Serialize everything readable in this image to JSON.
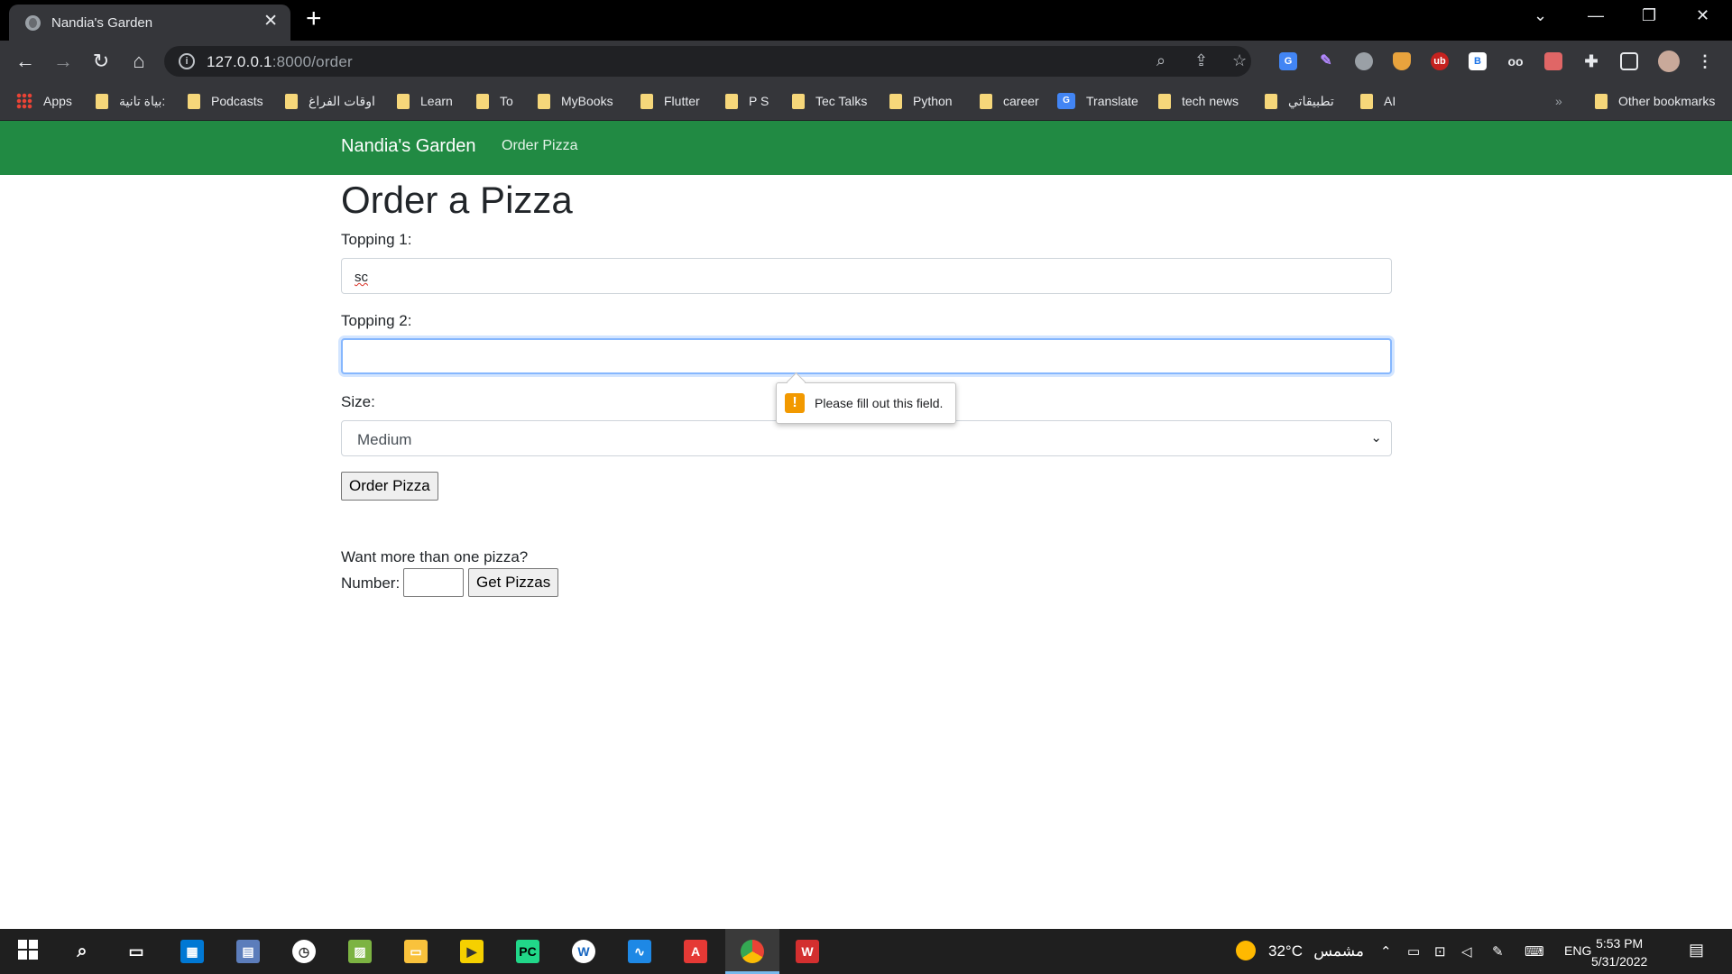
{
  "browser": {
    "tab_title": "Nandia's Garden",
    "tab_close": "✕",
    "new_tab": "+",
    "window_controls": [
      "⌄",
      "—",
      "❐",
      "✕"
    ],
    "url_host": "127.0.0.1",
    "url_rest": ":8000/order",
    "nav_icons": [
      "back-icon",
      "forward-icon",
      "reload-icon",
      "home-icon"
    ],
    "bookmarks": [
      {
        "label": "Apps",
        "icon": "apps-icon"
      },
      {
        "label": "بياة تانية:",
        "icon": "folder-icon"
      },
      {
        "label": "Podcasts",
        "icon": "folder-icon"
      },
      {
        "label": "اوقات الفراغ",
        "icon": "folder-icon"
      },
      {
        "label": "Learn",
        "icon": "folder-icon"
      },
      {
        "label": "To",
        "icon": "folder-icon"
      },
      {
        "label": "MyBooks",
        "icon": "folder-icon"
      },
      {
        "label": "Flutter",
        "icon": "folder-icon"
      },
      {
        "label": "P S",
        "icon": "folder-icon"
      },
      {
        "label": "Tec Talks",
        "icon": "folder-icon"
      },
      {
        "label": "Python",
        "icon": "folder-icon"
      },
      {
        "label": "career",
        "icon": "folder-icon"
      },
      {
        "label": "Translate",
        "icon": "google-translate-icon"
      },
      {
        "label": "tech news",
        "icon": "folder-icon"
      },
      {
        "label": "تطبيقاتي",
        "icon": "folder-icon"
      },
      {
        "label": "AI",
        "icon": "folder-icon"
      }
    ],
    "other_bookmarks": "Other bookmarks",
    "bookmarks_overflow": "»"
  },
  "site": {
    "brand": "Nandia's Garden",
    "nav_link": "Order Pizza"
  },
  "form": {
    "heading": "Order a Pizza",
    "topping1_label": "Topping 1:",
    "topping1_value": "sc",
    "topping2_label": "Topping 2:",
    "topping2_value": "",
    "size_label": "Size:",
    "size_value": "Medium",
    "submit_label": "Order Pizza",
    "validation_message": "Please fill out this field.",
    "validation_icon": "!"
  },
  "multi": {
    "prompt": "Want more than one pizza?",
    "number_label": "Number:",
    "number_value": "",
    "button_label": "Get Pizzas"
  },
  "taskbar": {
    "weather_temp": "32°C",
    "weather_text": "مشمس",
    "language": "ENG",
    "time": "5:53 PM",
    "date": "5/31/2022"
  },
  "colors": {
    "navbar": "#218a43",
    "tooltip_warning": "#f29900",
    "chrome_dark": "#35363a"
  }
}
